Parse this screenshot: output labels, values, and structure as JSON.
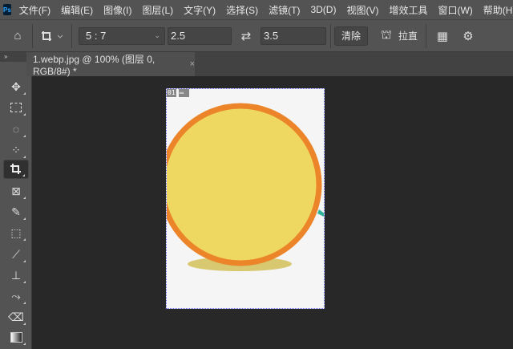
{
  "app": {
    "logo": "Ps"
  },
  "menu": [
    "文件(F)",
    "编辑(E)",
    "图像(I)",
    "图层(L)",
    "文字(Y)",
    "选择(S)",
    "滤镜(T)",
    "3D(D)",
    "视图(V)",
    "增效工具",
    "窗口(W)",
    "帮助(H)"
  ],
  "options": {
    "ratio": "5 : 7",
    "width": "2.5",
    "height": "3.5",
    "clear": "清除",
    "straighten": "拉直"
  },
  "document": {
    "tab_title": "1.webp.jpg @ 100% (图层 0, RGB/8#) *",
    "close": "×",
    "slice_number": "01"
  },
  "toolbar": {
    "collapse": "»"
  },
  "colors": {
    "circle_fill": "#eed862",
    "circle_stroke": "#ec8429",
    "shadow": "#d8c870",
    "teal": "#2fb39a"
  }
}
